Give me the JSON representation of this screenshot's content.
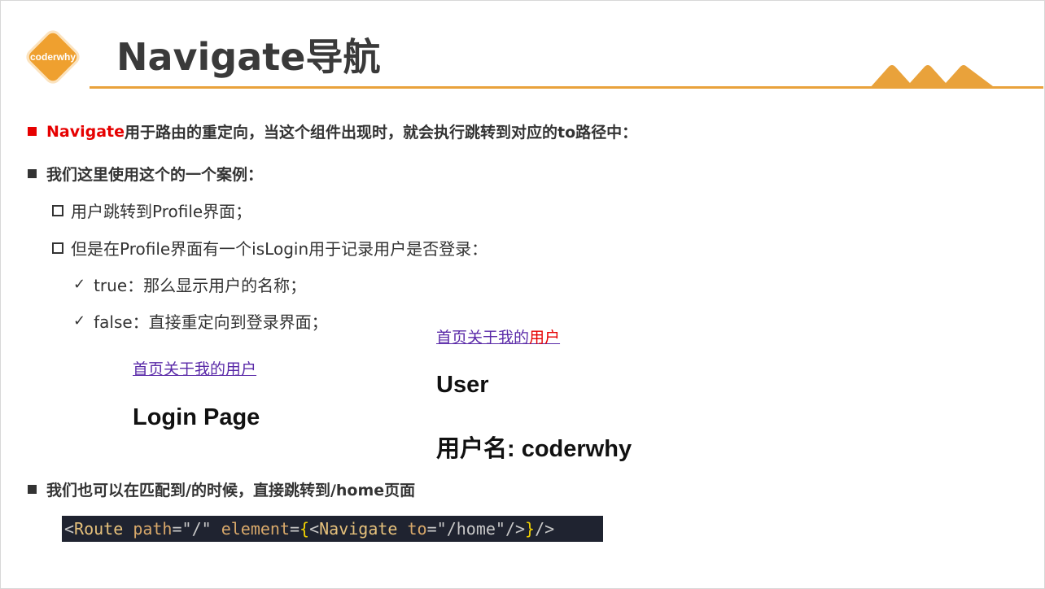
{
  "logo": {
    "text": "coderwhy"
  },
  "title": "Navigate导航",
  "bullets": {
    "b1": {
      "highlight": "Navigate",
      "rest": "用于路由的重定向，当这个组件出现时，就会执行跳转到对应的to路径中："
    },
    "b2": "我们这里使用这个的一个案例：",
    "b2_sub": [
      "用户跳转到Profile界面；",
      "但是在Profile界面有一个isLogin用于记录用户是否登录："
    ],
    "b2_checks": [
      "true：那么显示用户的名称；",
      "false：直接重定向到登录界面；"
    ],
    "b3": "我们也可以在匹配到/的时候，直接跳转到/home页面"
  },
  "demo_left": {
    "links": [
      "首页",
      "关于",
      "我的",
      "用户"
    ],
    "heading": "Login Page"
  },
  "demo_right": {
    "links": [
      "首页",
      "关于",
      "我的",
      "用户"
    ],
    "heading": "User",
    "username": "用户名: coderwhy"
  },
  "code": {
    "open": "<",
    "route": "Route",
    "path_attr": "path",
    "eq1": "=",
    "path_val": "\"/\"",
    "element_attr": "element",
    "eq2": "=",
    "brace_open": "{",
    "lt2": "<",
    "navigate": "Navigate",
    "to_attr": "to",
    "eq3": "=",
    "to_val": "\"/home\"",
    "self_close": "/>",
    "brace_close": "}",
    "end": "/>"
  },
  "colors": {
    "accent": "#e9a23b",
    "red": "#e60000",
    "link": "#5a2aa8",
    "code_bg": "#1f2330"
  }
}
